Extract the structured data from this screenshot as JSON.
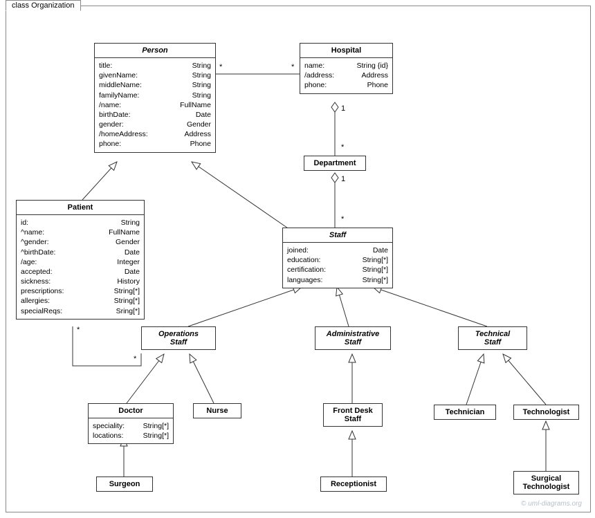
{
  "frame": {
    "title": "class Organization"
  },
  "watermark": "© uml-diagrams.org",
  "classes": {
    "person": {
      "name": "Person",
      "attrs": [
        [
          "title:",
          "String"
        ],
        [
          "givenName:",
          "String"
        ],
        [
          "middleName:",
          "String"
        ],
        [
          "familyName:",
          "String"
        ],
        [
          "/name:",
          "FullName"
        ],
        [
          "birthDate:",
          "Date"
        ],
        [
          "gender:",
          "Gender"
        ],
        [
          "/homeAddress:",
          "Address"
        ],
        [
          "phone:",
          "Phone"
        ]
      ]
    },
    "hospital": {
      "name": "Hospital",
      "attrs": [
        [
          "name:",
          "String {id}"
        ],
        [
          "/address:",
          "Address"
        ],
        [
          "phone:",
          "Phone"
        ]
      ]
    },
    "department": {
      "name": "Department"
    },
    "patient": {
      "name": "Patient",
      "attrs": [
        [
          "id:",
          "String"
        ],
        [
          "^name:",
          "FullName"
        ],
        [
          "^gender:",
          "Gender"
        ],
        [
          "^birthDate:",
          "Date"
        ],
        [
          "/age:",
          "Integer"
        ],
        [
          "accepted:",
          "Date"
        ],
        [
          "sickness:",
          "History"
        ],
        [
          "prescriptions:",
          "String[*]"
        ],
        [
          "allergies:",
          "String[*]"
        ],
        [
          "specialReqs:",
          "Sring[*]"
        ]
      ]
    },
    "staff": {
      "name": "Staff",
      "attrs": [
        [
          "joined:",
          "Date"
        ],
        [
          "education:",
          "String[*]"
        ],
        [
          "certification:",
          "String[*]"
        ],
        [
          "languages:",
          "String[*]"
        ]
      ]
    },
    "ops": {
      "name": "Operations",
      "name2": "Staff"
    },
    "admin": {
      "name": "Administrative",
      "name2": "Staff"
    },
    "tech": {
      "name": "Technical",
      "name2": "Staff"
    },
    "doctor": {
      "name": "Doctor",
      "attrs": [
        [
          "speciality:",
          "String[*]"
        ],
        [
          "locations:",
          "String[*]"
        ]
      ]
    },
    "nurse": {
      "name": "Nurse"
    },
    "frontdesk": {
      "name": "Front Desk",
      "name2": "Staff"
    },
    "technician": {
      "name": "Technician"
    },
    "technologist": {
      "name": "Technologist"
    },
    "surgeon": {
      "name": "Surgeon"
    },
    "receptionist": {
      "name": "Receptionist"
    },
    "surgtech": {
      "name": "Surgical",
      "name2": "Technologist"
    }
  },
  "mults": {
    "m1": "*",
    "m2": "*",
    "m3": "1",
    "m4": "*",
    "m5": "1",
    "m6": "*",
    "m7": "*",
    "m8": "*"
  }
}
